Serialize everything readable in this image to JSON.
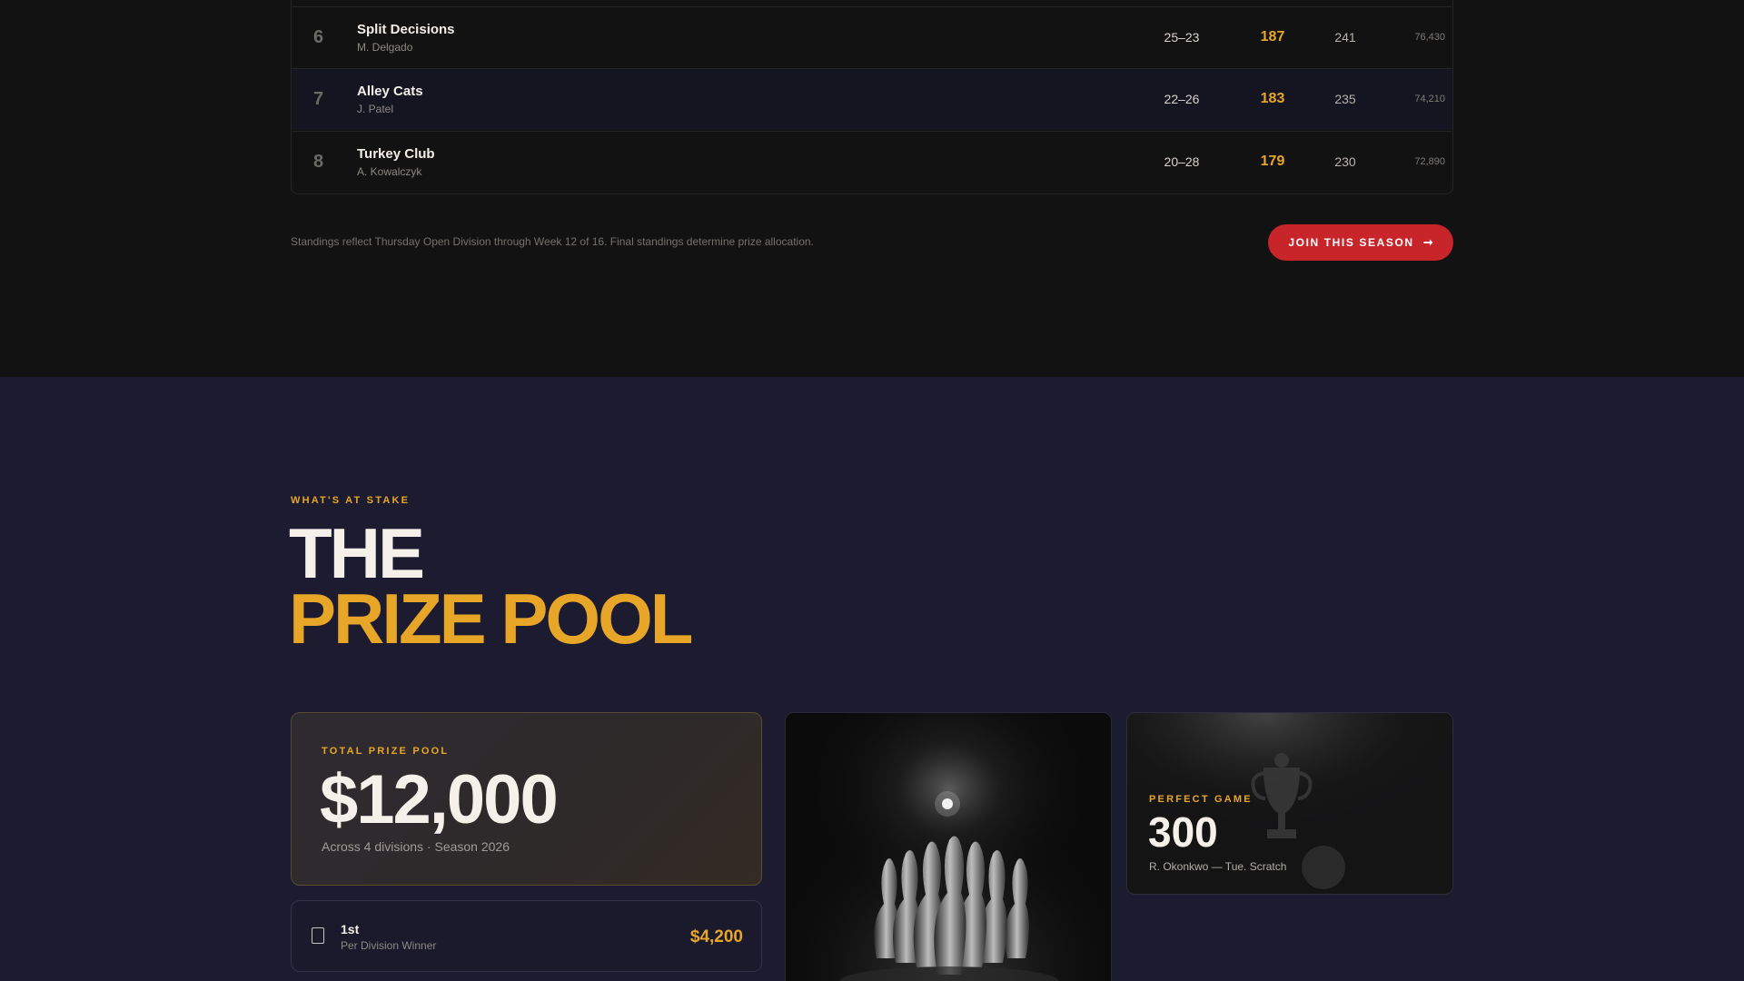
{
  "standings": {
    "rows": [
      {
        "rank": "6",
        "team": "Split Decisions",
        "captain": "M. Delgado",
        "record": "25–23",
        "average": "187",
        "high_game": "241",
        "total_pins": "76,430"
      },
      {
        "rank": "7",
        "team": "Alley Cats",
        "captain": "J. Patel",
        "record": "22–26",
        "average": "183",
        "high_game": "235",
        "total_pins": "74,210"
      },
      {
        "rank": "8",
        "team": "Turkey Club",
        "captain": "A. Kowalczyk",
        "record": "20–28",
        "average": "179",
        "high_game": "230",
        "total_pins": "72,890"
      }
    ],
    "footnote": "Standings reflect Thursday Open Division through Week 12 of 16. Final standings determine prize allocation.",
    "join_button": {
      "label": "JOIN THIS SEASON",
      "icon": "arrow-right-icon"
    }
  },
  "prize_pool": {
    "eyebrow": "WHAT'S AT STAKE",
    "headline_line1": "THE",
    "headline_line2": "PRIZE POOL",
    "total": {
      "label": "TOTAL PRIZE POOL",
      "amount": "$12,000",
      "subtitle": "Across 4 divisions · Season 2026"
    },
    "places": [
      {
        "place": "1st",
        "description": "Per Division Winner",
        "amount": "$4,200",
        "icon": "trophy-icon"
      }
    ],
    "perfect_game": {
      "label": "PERFECT GAME",
      "score": "300",
      "holder": "R. Okonkwo — Tue. Scratch"
    }
  },
  "colors": {
    "accent": "#e8a628",
    "cta": "#c8252b",
    "dark_bg": "#131212",
    "navy_bg": "#1c1b30"
  }
}
